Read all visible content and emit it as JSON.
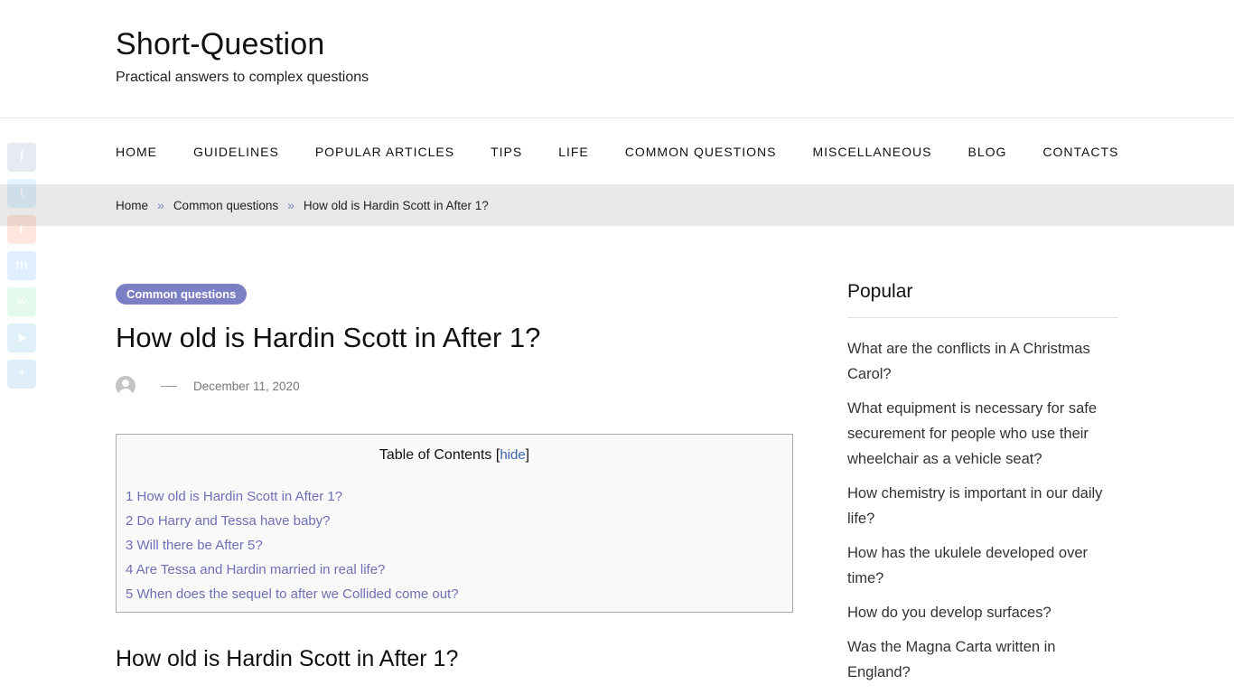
{
  "site": {
    "title": "Short-Question",
    "tagline": "Practical answers to complex questions"
  },
  "nav": {
    "items": [
      "HOME",
      "GUIDELINES",
      "POPULAR ARTICLES",
      "TIPS",
      "LIFE",
      "COMMON QUESTIONS",
      "MISCELLANEOUS",
      "BLOG",
      "CONTACTS"
    ]
  },
  "breadcrumb": {
    "home": "Home",
    "category": "Common questions",
    "current": "How old is Hardin Scott in After 1?",
    "separator": "»"
  },
  "share": {
    "icons": [
      {
        "name": "facebook-icon",
        "glyph": "f",
        "color": "#3b5998"
      },
      {
        "name": "twitter-icon",
        "glyph": "t",
        "color": "#1da1f2"
      },
      {
        "name": "reddit-icon",
        "glyph": "r",
        "color": "#ff4500"
      },
      {
        "name": "messenger-icon",
        "glyph": "m",
        "color": "#0084ff"
      },
      {
        "name": "whatsapp-icon",
        "glyph": "w",
        "color": "#25d366"
      },
      {
        "name": "telegram-icon",
        "glyph": "➤",
        "color": "#0088cc"
      },
      {
        "name": "share-more-icon",
        "glyph": "+",
        "color": "#0d7bd1"
      }
    ]
  },
  "article": {
    "category": "Common questions",
    "title": "How old is Hardin Scott in After 1?",
    "date": "December 11, 2020",
    "dash": "—"
  },
  "toc": {
    "title": "Table of Contents",
    "toggle_open": "[",
    "toggle_label": "hide",
    "toggle_close": "]",
    "items": [
      "1 How old is Hardin Scott in After 1?",
      "2 Do Harry and Tessa have baby?",
      "3 Will there be After 5?",
      "4 Are Tessa and Hardin married in real life?",
      "5 When does the sequel to after we Collided come out?"
    ]
  },
  "section": {
    "heading": "How old is Hardin Scott in After 1?"
  },
  "sidebar": {
    "title": "Popular",
    "items": [
      "What are the conflicts in A Christmas Carol?",
      "What equipment is necessary for safe securement for people who use their wheelchair as a vehicle seat?",
      "How chemistry is important in our daily life?",
      "How has the ukulele developed over time?",
      "How do you develop surfaces?",
      "Was the Magna Carta written in England?"
    ]
  }
}
